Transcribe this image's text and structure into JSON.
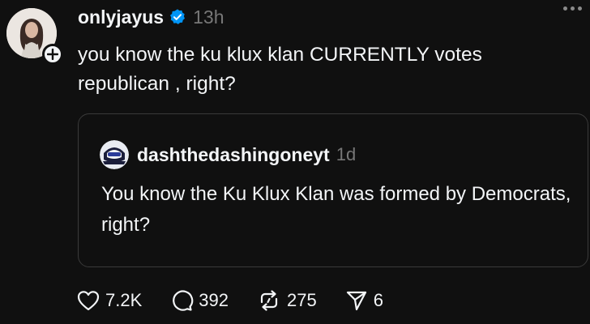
{
  "post": {
    "username": "onlyjayus",
    "timestamp": "13h",
    "text": "you know the ku klux klan CURRENTLY votes republican , right?"
  },
  "quoted_post": {
    "username": "dashthedashingoneyt",
    "timestamp": "1d",
    "text": "You know the Ku Klux Klan was formed by Democrats, right?"
  },
  "actions": {
    "likes": "7.2K",
    "replies": "392",
    "reposts": "275",
    "shares": "6"
  },
  "icons": {
    "verified": "verified-badge-icon",
    "follow": "plus-icon",
    "more": "more-horizontal-icon",
    "like": "heart-icon",
    "reply": "comment-bubble-icon",
    "repost": "repost-arrows-icon",
    "share": "send-paper-plane-icon"
  },
  "colors": {
    "background": "#101010",
    "text": "#f3f5f7",
    "muted": "#777777",
    "verified": "#0095f6",
    "border": "#3a3a3a"
  }
}
